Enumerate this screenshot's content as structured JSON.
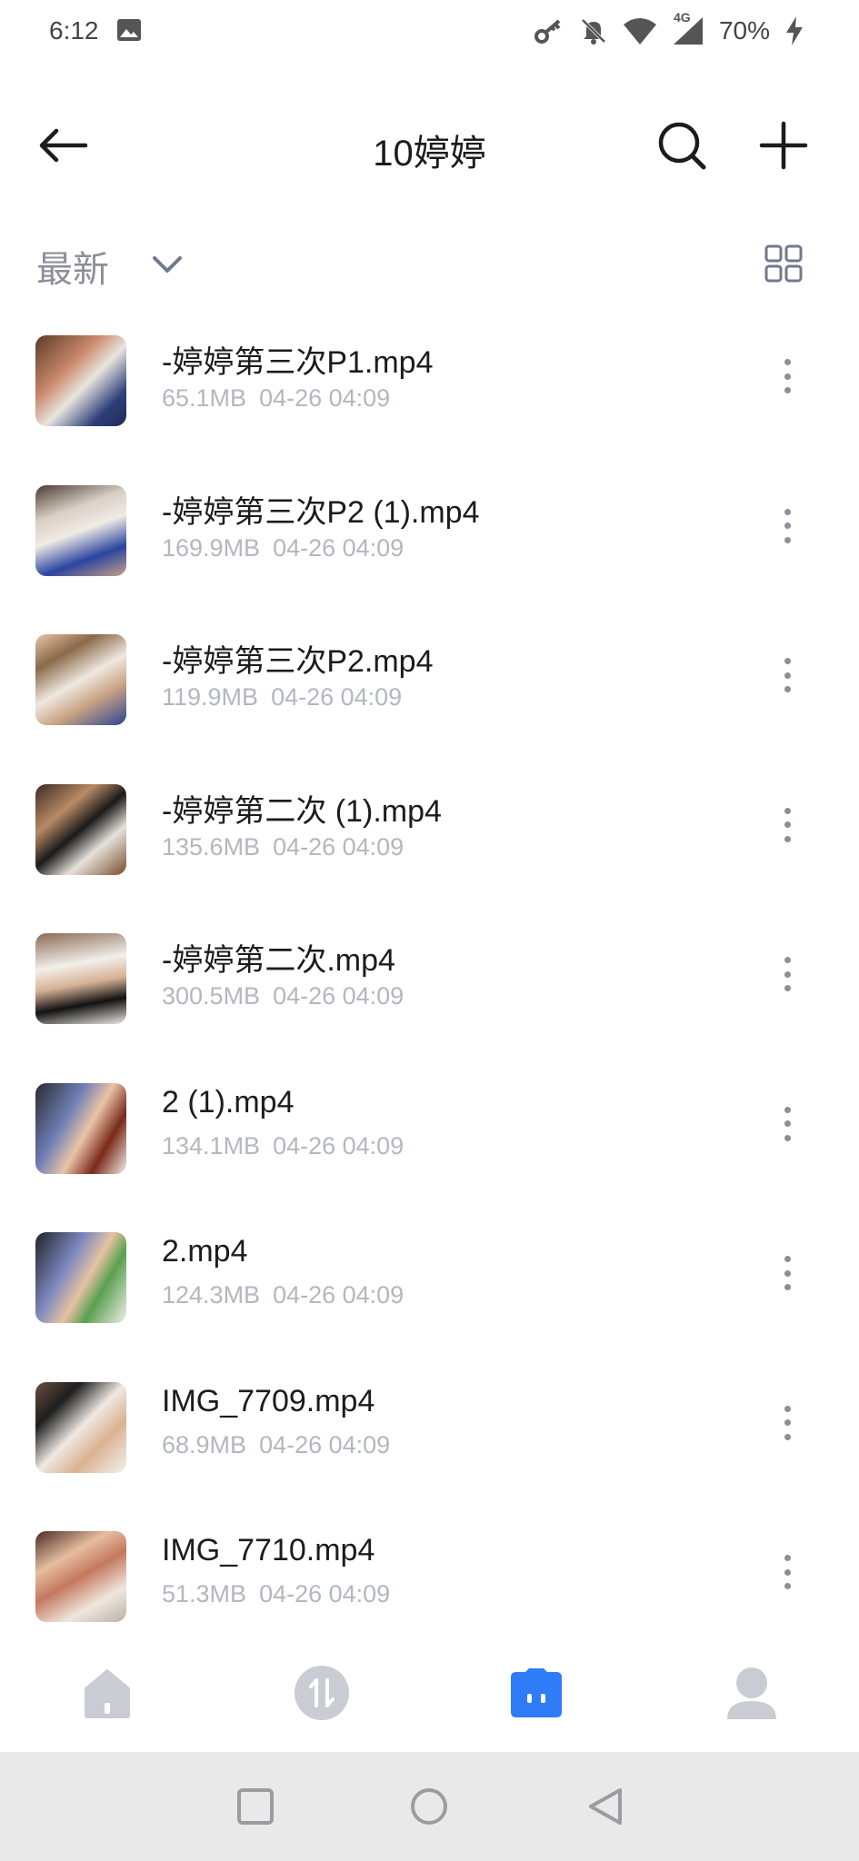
{
  "status_bar": {
    "time": "6:12",
    "battery": "70%",
    "network": "4G"
  },
  "header": {
    "title": "10婷婷"
  },
  "sort": {
    "label": "最新"
  },
  "files": [
    {
      "name": "-婷婷第三次P1.mp4",
      "size": "65.1MB",
      "date": "04-26 04:09"
    },
    {
      "name": "-婷婷第三次P2 (1).mp4",
      "size": "169.9MB",
      "date": "04-26 04:09"
    },
    {
      "name": "-婷婷第三次P2.mp4",
      "size": "119.9MB",
      "date": "04-26 04:09"
    },
    {
      "name": "-婷婷第二次 (1).mp4",
      "size": "135.6MB",
      "date": "04-26 04:09"
    },
    {
      "name": "-婷婷第二次.mp4",
      "size": "300.5MB",
      "date": "04-26 04:09"
    },
    {
      "name": "2 (1).mp4",
      "size": "134.1MB",
      "date": "04-26 04:09"
    },
    {
      "name": "2.mp4",
      "size": "124.3MB",
      "date": "04-26 04:09"
    },
    {
      "name": "IMG_7709.mp4",
      "size": "68.9MB",
      "date": "04-26 04:09"
    },
    {
      "name": "IMG_7710.mp4",
      "size": "51.3MB",
      "date": "04-26 04:09"
    }
  ],
  "icons": {
    "back": "arrow-left-icon",
    "search": "search-icon",
    "add": "plus-icon",
    "sort_toggle": "chevron-down-icon",
    "view_toggle": "grid-view-icon",
    "more": "more-vertical-icon",
    "nav": [
      "home-icon",
      "transfer-icon",
      "files-icon",
      "profile-icon"
    ]
  },
  "colors": {
    "accent": "#2f7cf6",
    "nav_inactive": "#c9ccd2",
    "meta_text": "#b3b7bf"
  },
  "bottom_nav": {
    "active_index": 2
  }
}
